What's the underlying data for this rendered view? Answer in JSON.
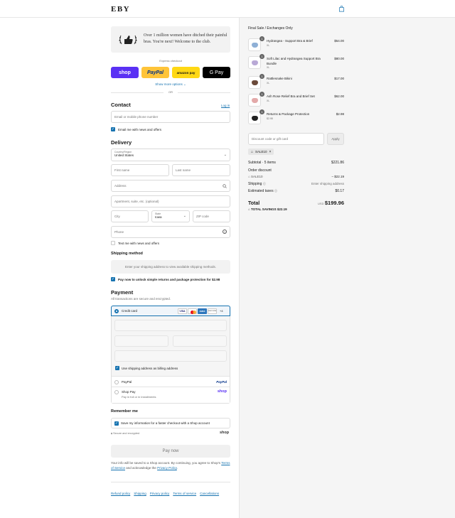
{
  "header": {
    "logo": "EBY",
    "cart_icon": "shopping-bag-icon"
  },
  "banner": {
    "text": "Over 1 million women have ditched their painful bras. You're next! Welcome to the club."
  },
  "express": {
    "title": "Express checkout",
    "buttons": [
      {
        "label": "shop",
        "bg": "#5a31f4",
        "fg": "#ffffff"
      },
      {
        "label": "PayPal",
        "bg": "#ffc439",
        "fg": "#003087"
      },
      {
        "label": "amazon pay",
        "bg": "#ffd814",
        "fg": "#111111"
      },
      {
        "label": "G Pay",
        "bg": "#000000",
        "fg": "#ffffff"
      }
    ],
    "show_more": "Show more options",
    "or": "OR"
  },
  "contact": {
    "title": "Contact",
    "login": "Log in",
    "email_placeholder": "Email or mobile phone number",
    "news_label": "Email me with news and offers"
  },
  "delivery": {
    "title": "Delivery",
    "country_label": "Country/Region",
    "country_value": "United States",
    "first_name": "First name",
    "last_name": "Last name",
    "address": "Address",
    "apartment": "Apartment, suite, etc. (optional)",
    "city": "City",
    "state_label": "State",
    "state_value": "Iowa",
    "zip": "ZIP code",
    "phone": "Phone",
    "text_label": "Text me with news and offers"
  },
  "shipping": {
    "title": "Shipping method",
    "message": "Enter your shipping address to view available shipping methods.",
    "protect_label": "Pay now to unlock simple returns and package protection for $2.98"
  },
  "payment": {
    "title": "Payment",
    "subtitle": "All transactions are secure and encrypted.",
    "credit_card": "Credit card",
    "card_brands": [
      "VISA",
      "MC",
      "AMEX",
      "DISCOVER"
    ],
    "more_brands": "+4",
    "billing_label": "Use shipping address as billing address",
    "paypal_label": "PayPal",
    "paypal_logo": "PayPal",
    "shoppay_label": "Shop Pay",
    "shoppay_sub": "Pay in full or in installments",
    "shoppay_logo": "shop"
  },
  "remember": {
    "title": "Remember me",
    "save_label": "Save my information for a faster checkout with a Shop account",
    "secure": "Secure and encrypted",
    "shop_logo": "shop"
  },
  "pay_button": "Pay now",
  "legal": {
    "prefix": "Your info will be saved to a Shop account. By continuing, you agree to Shop's",
    "terms": "Terms of Service",
    "middle": "and acknowledge the",
    "privacy": "Privacy Policy",
    "end": "."
  },
  "footer": [
    "Refund policy",
    "Shipping",
    "Privacy policy",
    "Terms of service",
    "Cancellations"
  ],
  "summary": {
    "notice": "Final Sale / Exchanges Only",
    "items": [
      {
        "qty": "1",
        "name": "Hydrangea - Support Bra & Brief",
        "variant": "XL",
        "price": "$54.00",
        "color": "#8fb0d6"
      },
      {
        "qty": "1",
        "name": "Soft Lilac and Hydrangea Support Bra Bundle",
        "variant": "XL",
        "price": "$80.00",
        "color": "#b9a9d6"
      },
      {
        "qty": "1",
        "name": "Rattlesnake Bikini",
        "variant": "XL",
        "price": "$17.00",
        "color": "#6b4a3a"
      },
      {
        "qty": "1",
        "name": "Ash Rose Relief Bra and Brief Set",
        "variant": "XL",
        "price": "$62.00",
        "color": "#e3a9a9"
      },
      {
        "qty": "1",
        "name": "Returns & Package Protection",
        "variant": "$2.98",
        "price": "$2.98",
        "color": "#222222"
      }
    ],
    "discount_placeholder": "Discount code or gift card",
    "apply": "Apply",
    "applied_code": "SALE10",
    "subtotal_label": "Subtotal · 5 items",
    "subtotal": "$221.86",
    "order_discount_label": "Order discount",
    "discount_code": "SALE10",
    "discount_amount": "– $22.19",
    "shipping_label": "Shipping",
    "shipping_value": "Enter shipping address",
    "taxes_label": "Estimated taxes",
    "taxes": "$0.17",
    "total_label": "Total",
    "currency": "USD",
    "total": "$199.96",
    "savings_label": "TOTAL SAVINGS",
    "savings": "$22.19"
  }
}
